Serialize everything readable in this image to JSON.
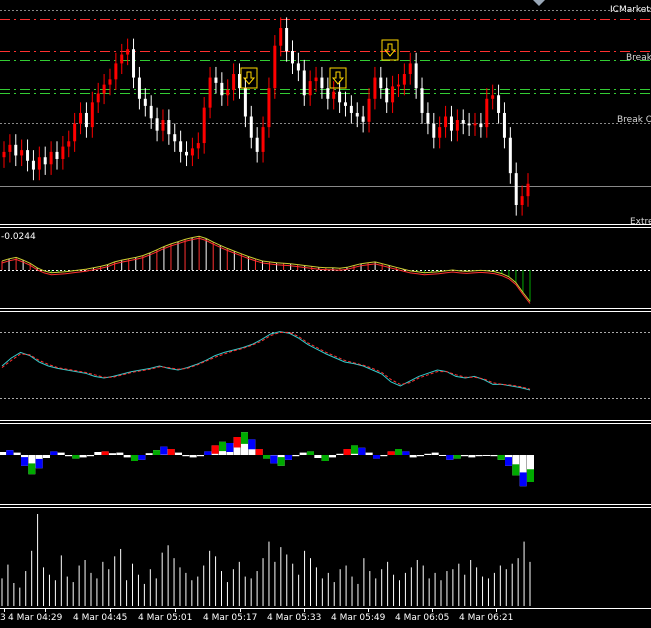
{
  "header": {
    "broker_label": "ICMarkets"
  },
  "colors": {
    "background": "#000000",
    "bull_candle": "#ff0000",
    "bear_candle": "#ffffff",
    "level_red": "#ff3030",
    "level_green": "#33cc33",
    "level_grey": "#888888",
    "arrow_marker": "#ffd700",
    "signal_line": "#ff3030",
    "main_line": "#33cccc",
    "hist_blue": "#0000ff",
    "hist_green": "#00aa00",
    "panel_border": "#ffffff"
  },
  "main_panel": {
    "level_labels": {
      "break_upper": "Break",
      "break_lower": "Break O",
      "extreme": "Extre"
    }
  },
  "oscillator_panel": {
    "value_label": "-0.0244"
  },
  "chart_data": [
    {
      "type": "candlestick",
      "panel": "price",
      "levels": [
        "dash-red",
        "dash-red",
        "dash-green",
        "dash-green",
        "dot-grey",
        "solid-grey"
      ],
      "arrow_markers": [
        4,
        7,
        10
      ],
      "closes": [
        0.3,
        0.34,
        0.28,
        0.31,
        0.25,
        0.2,
        0.27,
        0.23,
        0.3,
        0.26,
        0.33,
        0.36,
        0.46,
        0.52,
        0.44,
        0.58,
        0.63,
        0.68,
        0.71,
        0.8,
        0.85,
        0.88,
        0.72,
        0.6,
        0.56,
        0.49,
        0.42,
        0.48,
        0.4,
        0.36,
        0.3,
        0.28,
        0.32,
        0.35,
        0.55,
        0.72,
        0.69,
        0.62,
        0.65,
        0.74,
        0.66,
        0.5,
        0.38,
        0.3,
        0.44,
        0.66,
        0.9,
        1.0,
        0.87,
        0.8,
        0.76,
        0.62,
        0.7,
        0.72,
        0.66,
        0.6,
        0.64,
        0.58,
        0.56,
        0.52,
        0.5,
        0.47,
        0.6,
        0.72,
        0.66,
        0.58,
        0.67,
        0.68,
        0.74,
        0.8,
        0.66,
        0.52,
        0.46,
        0.38,
        0.44,
        0.5,
        0.42,
        0.48,
        0.46,
        0.45,
        0.46,
        0.44,
        0.6,
        0.62,
        0.52,
        0.38,
        0.18,
        0.0,
        0.05,
        0.12
      ]
    },
    {
      "type": "histogram",
      "panel": "oscillator",
      "values": [
        0.2,
        0.25,
        0.28,
        0.22,
        0.15,
        0.05,
        -0.02,
        -0.06,
        -0.05,
        -0.04,
        -0.02,
        0.0,
        0.02,
        0.05,
        0.08,
        0.12,
        0.18,
        0.22,
        0.25,
        0.28,
        0.32,
        0.38,
        0.45,
        0.52,
        0.58,
        0.63,
        0.68,
        0.72,
        0.75,
        0.7,
        0.62,
        0.55,
        0.48,
        0.42,
        0.36,
        0.3,
        0.25,
        0.2,
        0.18,
        0.16,
        0.15,
        0.14,
        0.12,
        0.1,
        0.08,
        0.06,
        0.05,
        0.05,
        0.04,
        0.06,
        0.1,
        0.14,
        0.16,
        0.18,
        0.14,
        0.1,
        0.06,
        0.02,
        -0.02,
        -0.04,
        -0.06,
        -0.05,
        -0.04,
        -0.02,
        0.0,
        -0.02,
        -0.03,
        -0.02,
        -0.01,
        -0.02,
        -0.04,
        -0.08,
        -0.15,
        -0.28,
        -0.5,
        -0.7
      ]
    },
    {
      "type": "line",
      "panel": "stochastic",
      "series": [
        {
          "role": "main",
          "values": [
            45,
            55,
            62,
            58,
            50,
            45,
            42,
            40,
            38,
            36,
            32,
            30,
            32,
            35,
            38,
            40,
            42,
            45,
            42,
            40,
            43,
            47,
            52,
            58,
            62,
            65,
            68,
            72,
            78,
            85,
            88,
            86,
            80,
            72,
            66,
            60,
            55,
            50,
            48,
            45,
            40,
            35,
            25,
            20,
            26,
            32,
            36,
            40,
            38,
            32,
            30,
            32,
            28,
            22,
            22,
            20,
            18,
            15
          ]
        },
        {
          "role": "signal",
          "values": [
            43,
            52,
            60,
            59,
            52,
            47,
            43,
            41,
            39,
            37,
            34,
            31,
            31,
            34,
            37,
            39,
            41,
            44,
            43,
            41,
            42,
            46,
            51,
            56,
            60,
            64,
            67,
            71,
            76,
            83,
            87,
            87,
            82,
            74,
            68,
            62,
            57,
            52,
            49,
            46,
            42,
            37,
            28,
            22,
            24,
            30,
            34,
            38,
            38,
            34,
            31,
            31,
            29,
            24,
            22,
            21,
            19,
            16
          ]
        }
      ]
    },
    {
      "type": "bar",
      "panel": "histogram-colored",
      "values": [
        0.05,
        0.08,
        0.04,
        -0.18,
        -0.32,
        -0.22,
        -0.05,
        0.06,
        0.04,
        -0.02,
        -0.06,
        -0.04,
        -0.02,
        0.05,
        0.06,
        0.03,
        0.04,
        -0.04,
        -0.1,
        -0.08,
        0.03,
        0.08,
        0.14,
        0.1,
        0.04,
        -0.02,
        -0.04,
        -0.02,
        0.06,
        0.16,
        0.22,
        0.2,
        0.3,
        0.38,
        0.26,
        0.1,
        -0.06,
        -0.14,
        -0.18,
        -0.08,
        -0.02,
        0.04,
        0.06,
        -0.05,
        -0.1,
        -0.04,
        0.02,
        0.1,
        0.16,
        0.12,
        0.04,
        -0.06,
        -0.02,
        0.06,
        0.1,
        0.06,
        -0.04,
        -0.02,
        0.02,
        0.04,
        0.0,
        -0.08,
        -0.06,
        -0.02,
        -0.04,
        -0.02,
        0.0,
        -0.02,
        -0.08,
        -0.18,
        -0.34,
        -0.52,
        -0.45
      ]
    },
    {
      "type": "bar",
      "panel": "volume",
      "values": [
        30,
        45,
        25,
        20,
        38,
        60,
        100,
        42,
        34,
        28,
        55,
        32,
        26,
        44,
        50,
        36,
        30,
        48,
        40,
        54,
        62,
        28,
        46,
        34,
        24,
        40,
        30,
        58,
        66,
        52,
        42,
        36,
        28,
        32,
        44,
        60,
        54,
        38,
        26,
        40,
        48,
        32,
        30,
        38,
        52,
        70,
        48,
        64,
        56,
        46,
        34,
        60,
        52,
        42,
        30,
        36,
        26,
        40,
        44,
        32,
        24,
        52,
        38,
        30,
        40,
        48,
        34,
        28,
        36,
        42,
        50,
        44,
        30,
        36,
        28,
        38,
        40,
        46,
        34,
        50,
        42,
        32,
        30,
        36,
        44,
        40,
        46,
        52,
        70,
        48
      ]
    }
  ],
  "time_axis": {
    "labels": [
      "3",
      "4 Mar 04:29",
      "4 Mar 04:45",
      "4 Mar 05:01",
      "4 Mar 05:17",
      "4 Mar 05:33",
      "4 Mar 05:49",
      "4 Mar 06:05",
      "4 Mar 06:21"
    ]
  }
}
